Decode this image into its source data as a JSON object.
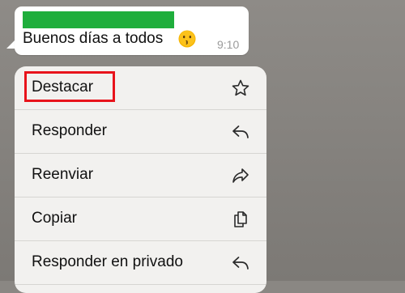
{
  "message": {
    "sender_color": "#1fae3c",
    "text": "Buenos días a todos",
    "emoji_icon": "kissing-face-emoji",
    "time": "9:10"
  },
  "context_menu": {
    "items": [
      {
        "label": "Destacar",
        "icon": "star-icon"
      },
      {
        "label": "Responder",
        "icon": "reply-icon"
      },
      {
        "label": "Reenviar",
        "icon": "forward-icon"
      },
      {
        "label": "Copiar",
        "icon": "copy-icon"
      },
      {
        "label": "Responder en privado",
        "icon": "reply-private-icon"
      }
    ],
    "highlighted_item": "Destacar",
    "highlight_color": "#e8131b"
  }
}
